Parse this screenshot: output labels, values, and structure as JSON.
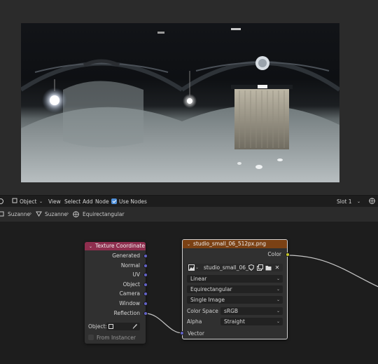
{
  "header": {
    "mode": "Object",
    "menu": [
      "View",
      "Select",
      "Add",
      "Node"
    ],
    "use_nodes_label": "Use Nodes",
    "slot": "Slot 1"
  },
  "breadcrumb": {
    "object": "Suzanne",
    "material": "Suzanne",
    "world": "Equirectangular"
  },
  "texture_coordinate_node": {
    "title": "Texture Coordinate",
    "outputs": [
      "Generated",
      "Normal",
      "UV",
      "Object",
      "Camera",
      "Window",
      "Reflection"
    ],
    "object_label": "Object:",
    "from_instancer": "From Instancer"
  },
  "image_texture_node": {
    "title": "studio_small_06_512px.png",
    "output_color": "Color",
    "image_name": "studio_small_06_...",
    "interpolation": "Linear",
    "projection": "Equirectangular",
    "extension": "Single Image",
    "color_space_label": "Color Space",
    "color_space": "sRGB",
    "alpha_label": "Alpha",
    "alpha": "Straight",
    "input_vector": "Vector"
  },
  "colors": {
    "tex_coord_header": "#8e2e4e",
    "image_texture_header": "#7b4114",
    "vector_socket": "#6363c7",
    "color_socket": "#c7c729",
    "checkbox": "#4f8fd8"
  }
}
